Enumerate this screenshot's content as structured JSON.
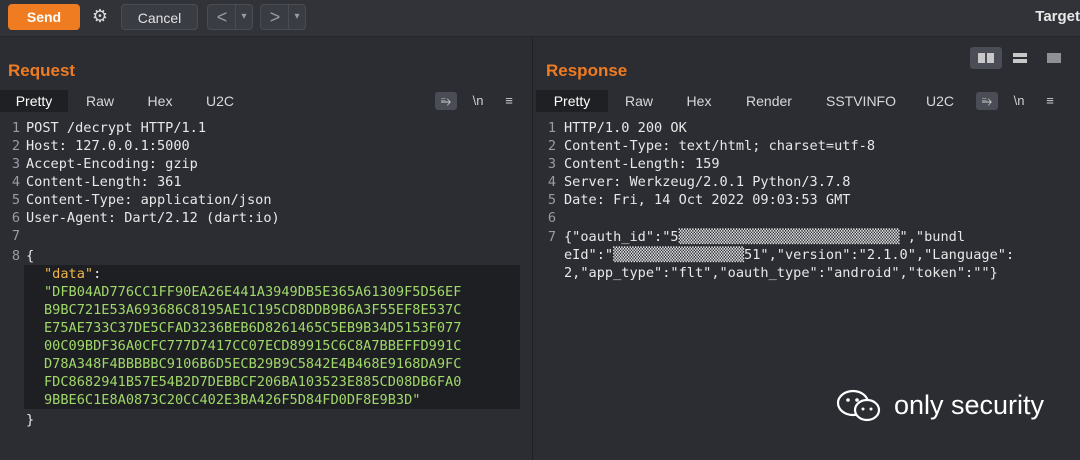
{
  "toolbar": {
    "send_label": "Send",
    "cancel_label": "Cancel",
    "back_label": "<",
    "forward_label": ">",
    "dropdown_glyph": "▾",
    "target_label": "Target"
  },
  "request": {
    "title": "Request",
    "tabs": [
      "Pretty",
      "Raw",
      "Hex",
      "U2C"
    ],
    "active_tab": "Pretty",
    "icons": [
      "wrap-icon",
      "newline-icon",
      "menu-icon"
    ],
    "icon_glyphs": {
      "newline": "\\n",
      "menu": "≡"
    },
    "lines": [
      "POST /decrypt HTTP/1.1",
      "Host: 127.0.0.1:5000",
      "Accept-Encoding: gzip",
      "Content-Length: 361",
      "Content-Type: application/json",
      "User-Agent: Dart/2.12 (dart:io)",
      "",
      "{"
    ],
    "json_key": "\"data\"",
    "json_colon": ":",
    "json_value_lines": [
      "\"DFB04AD776CC1FF90EA26E441A3949DB5E365A61309F5D56EF",
      "B9BC721E53A693686C8195AE1C195CD8DDB9B6A3F55EF8E537C",
      "E75AE733C37DE5CFAD3236BEB6D8261465C5EB9B34D5153F077",
      "00C09BDF36A0CFC777D7417CC07ECD89915C6C8A7BBEFFD991C",
      "D78A348F4BBBBBC9106B6D5ECB29B9C5842E4B468E9168DA9FC",
      "FDC8682941B57E54B2D7DEBBCF206BA103523E885CD08DB6FA0",
      "9BBE6C1E8A0873C20CC402E3BA426F5D84FD0DF8E9B3D\""
    ],
    "closing": "}"
  },
  "response": {
    "title": "Response",
    "tabs": [
      "Pretty",
      "Raw",
      "Hex",
      "Render",
      "SSTVINFO",
      "U2C"
    ],
    "active_tab": "Pretty",
    "lines": [
      "HTTP/1.0 200 OK",
      "Content-Type: text/html; charset=utf-8",
      "Content-Length: 159",
      "Server: Werkzeug/2.0.1 Python/3.7.8",
      "Date: Fri, 14 Oct 2022 09:03:53 GMT",
      ""
    ],
    "body_lines": [
      "{\"oauth_id\":\"5▒▒▒▒▒▒▒▒▒▒▒▒▒▒▒▒▒▒▒▒▒▒▒▒▒▒▒\",\"bundl",
      "eId\":\"▒▒▒▒▒▒▒▒▒▒▒▒▒▒▒▒51\",\"version\":\"2.1.0\",\"Language\":",
      "2,\"app_type\":\"flt\",\"oauth_type\":\"android\",\"token\":\"\"}"
    ]
  },
  "watermark": {
    "text": "only security"
  },
  "colors": {
    "accent": "#f07c21",
    "background": "#2b2d33",
    "json_key": "#f0b548",
    "json_string": "#a0d86a"
  }
}
